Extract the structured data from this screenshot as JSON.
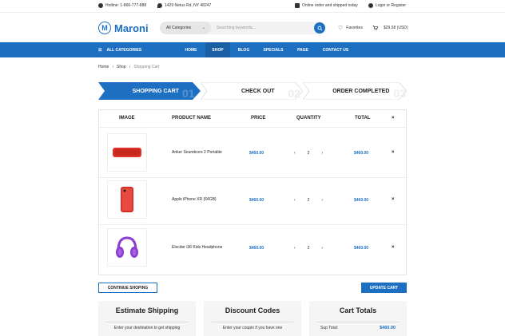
{
  "topbar": {
    "hotline": "Hotline: 1-866-777-888",
    "address": "1429 Netus Rd, NY 48247",
    "shipping": "Online order and shipped today",
    "login": "Login or Register"
  },
  "header": {
    "logo": "Maroni",
    "logo_letter": "M",
    "category": "All Categories",
    "search_placeholder": "Searching keywords...",
    "favorites": "Favorites",
    "cart_total": "$29.58 (USD)"
  },
  "nav": {
    "all_categories": "ALL CATEGORIES",
    "items": [
      {
        "label": "HOME"
      },
      {
        "label": "SHOP"
      },
      {
        "label": "BLOG"
      },
      {
        "label": "SPECIALS"
      },
      {
        "label": "PAGE"
      },
      {
        "label": "CONTACT US"
      }
    ]
  },
  "breadcrumb": {
    "home": "Home",
    "shop": "Shop",
    "current": "Shopping Cart"
  },
  "steps": [
    {
      "label": "SHOPPING CART",
      "num": "01"
    },
    {
      "label": "CHECK OUT",
      "num": "02"
    },
    {
      "label": "ORDER COMPLETED",
      "num": "03"
    }
  ],
  "cart": {
    "headers": {
      "image": "IMAGE",
      "product": "PRODUCT NAME",
      "price": "PRICE",
      "quantity": "QUANTITY",
      "total": "TOTAL",
      "remove": "×"
    },
    "rows": [
      {
        "name": "Anker Soundcore 2 Portable",
        "price": "$460.00",
        "qty": "2",
        "total": "$460.00",
        "minus": "‹",
        "plus": "›",
        "remove": "×",
        "image": "speaker-image"
      },
      {
        "name": "Apple iPhone XR (64GB)",
        "price": "$460.00",
        "qty": "2",
        "total": "$460.00",
        "minus": "‹",
        "plus": "›",
        "remove": "×",
        "image": "phone-image"
      },
      {
        "name": "Elecder i36 Kids Headphone",
        "price": "$460.00",
        "qty": "2",
        "total": "$460.00",
        "minus": "‹",
        "plus": "›",
        "remove": "×",
        "image": "headphone-image"
      }
    ]
  },
  "actions": {
    "continue": "CONTINUE SHOPING",
    "update": "UPDATE CART"
  },
  "boxes": {
    "shipping": {
      "title": "Estimate Shipping",
      "desc": "Enter your destination to get shipping"
    },
    "discount": {
      "title": "Discount Codes",
      "desc": "Enter your coupin if you have one"
    },
    "totals": {
      "title": "Cart Totals",
      "subtotal_label": "Sup Total:",
      "subtotal_value": "$460.00"
    }
  },
  "colors": {
    "accent": "#1d6fc2",
    "accent_dark": "#1a5fa6",
    "headphone": "#8b3fd1",
    "speaker": "#e0322b"
  }
}
